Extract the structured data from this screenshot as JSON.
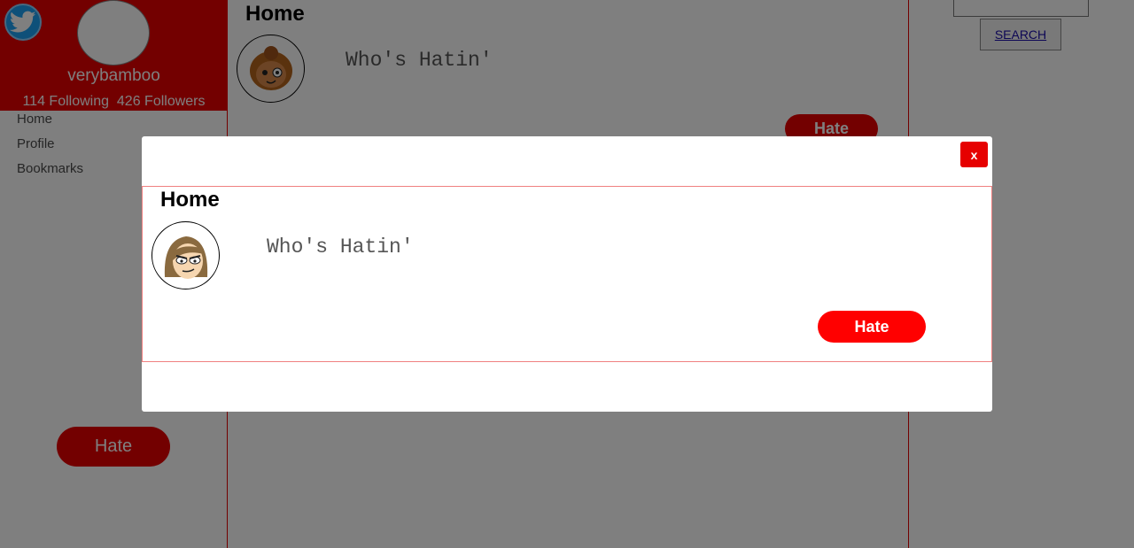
{
  "sidebar": {
    "logo_icon": "twitter-bird-icon",
    "username": "verybamboo",
    "following": "114 Following",
    "followers": "426 Followers",
    "nav": [
      {
        "label": "Home"
      },
      {
        "label": "Profile"
      },
      {
        "label": "Bookmarks"
      }
    ],
    "hate_button": "Hate"
  },
  "main": {
    "title": "Home",
    "tweet": {
      "text": "Who's Hatin'",
      "button": "Hate"
    }
  },
  "search": {
    "button": "SEARCH",
    "value": ""
  },
  "modal": {
    "close": "x",
    "title": "Home",
    "tweet_text": "Who's Hatin'",
    "button": "Hate"
  },
  "colors": {
    "accent": "#e60000",
    "button": "#ff0000",
    "twitter_blue": "#1da1f2"
  }
}
